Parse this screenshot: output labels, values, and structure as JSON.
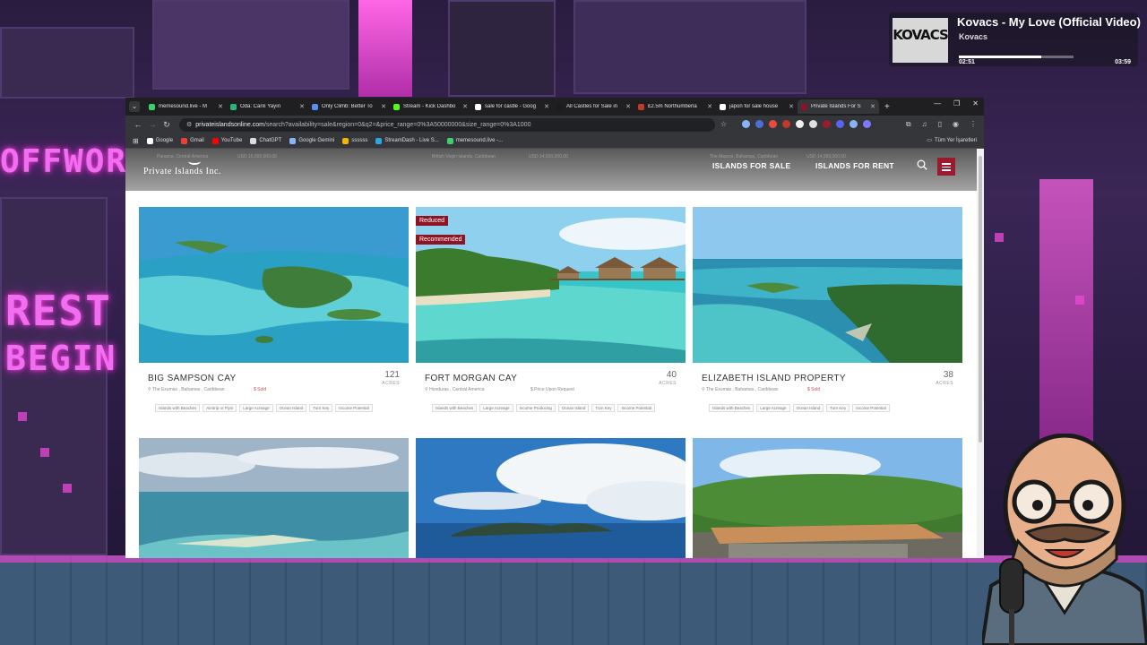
{
  "music": {
    "cover_text": "KOVACS",
    "title": "Kovacs - My Love (Official Video)",
    "artist": "Kovacs",
    "time_elapsed": "02:51",
    "time_total": "03:59",
    "progress": 0.72
  },
  "backdrop": {
    "neon_1": "OFFWOR",
    "neon_2": "REST",
    "neon_3": "BEGIN"
  },
  "browser": {
    "tabs": [
      {
        "label": "memesound.live - M",
        "color": "#3ecf6a"
      },
      {
        "label": "Oda: Canlı Yayın",
        "color": "#2ab47a"
      },
      {
        "label": "Only Climb: Better To",
        "color": "#5b8def"
      },
      {
        "label": "Stream - Kick Dashbo",
        "color": "#53fc18"
      },
      {
        "label": "sale for castle - Goog",
        "color": "#ffffff"
      },
      {
        "label": "All Castles for Sale in",
        "color": "#1b1b1b"
      },
      {
        "label": "£2.5m Northumberla",
        "color": "#c0392b"
      },
      {
        "label": "japon for sale house",
        "color": "#ffffff"
      },
      {
        "label": "Private Islands For S",
        "color": "#8c1424"
      }
    ],
    "url_domain": "privateislandsonline.com",
    "url_path": "/search?availability=sale&region=0&q2=&price_range=0%3A50000000&size_range=0%3A1000",
    "bookmarks": [
      {
        "label": "Google",
        "color": "#ffffff"
      },
      {
        "label": "Gmail",
        "color": "#ea4335"
      },
      {
        "label": "YouTube",
        "color": "#ff0000"
      },
      {
        "label": "ChatGPT",
        "color": "#dddddd"
      },
      {
        "label": "Google Gemini",
        "color": "#8ab4f8"
      },
      {
        "label": "ssssss",
        "color": "#f4b400"
      },
      {
        "label": "StreamDash - Live S...",
        "color": "#2aa7e0"
      },
      {
        "label": "memesound.live -...",
        "color": "#3ecf6a"
      }
    ],
    "bookmark_folder": "Tüm Yer İşaretleri"
  },
  "site": {
    "logo": "Private Islands Inc.",
    "nav": [
      "ISLANDS FOR SALE",
      "ISLANDS FOR RENT"
    ],
    "behind_header": [
      "Panama, Central America",
      "USD 15,000,000.00",
      "British Virgin Islands, Caribbean",
      "USD 14,500,000.00",
      "The Abacos, Bahamas, Caribbean",
      "USD 14,950,000.00"
    ]
  },
  "listings": [
    {
      "title": "BIG SAMPSON CAY",
      "acres": "121",
      "acres_label": "ACRES",
      "location": "The Exumas , Bahamas , Caribbean",
      "status": "Sold",
      "badges": [],
      "tags": [
        "Islands with Beaches",
        "Airstrip or Flyin",
        "Large Acreage",
        "Ocean Island",
        "Turn Key",
        "Income Potential"
      ]
    },
    {
      "title": "FORT MORGAN CAY",
      "acres": "40",
      "acres_label": "ACRES",
      "location": "Honduras , Central America",
      "status": "Price Upon Request",
      "badges": [
        "Reduced",
        "Recommended"
      ],
      "tags": [
        "Islands with Beaches",
        "Large Acreage",
        "Income Producing",
        "Ocean Island",
        "Turn Key",
        "Income Potential"
      ]
    },
    {
      "title": "ELIZABETH ISLAND PROPERTY",
      "acres": "38",
      "acres_label": "ACRES",
      "location": "The Exumas , Bahamas , Caribbean",
      "status": "Sold",
      "badges": [],
      "tags": [
        "Islands with Beaches",
        "Large Acreage",
        "Ocean Island",
        "Turn Key",
        "Income Potential"
      ]
    }
  ]
}
